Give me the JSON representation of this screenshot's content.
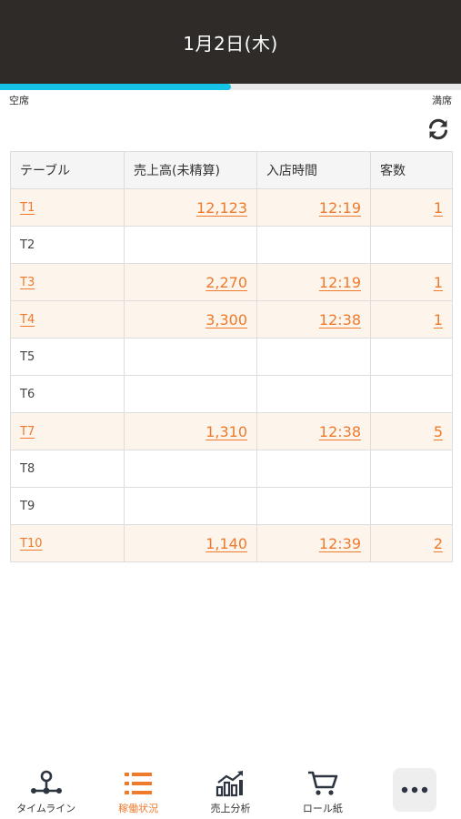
{
  "header": {
    "title": "1月2日(木)"
  },
  "occupancy": {
    "empty_label": "空席",
    "full_label": "満席",
    "level": 0.5
  },
  "table": {
    "headers": [
      "テーブル",
      "売上高(未精算)",
      "入店時間",
      "客数"
    ],
    "rows": [
      {
        "table": "T1",
        "sales": "12,123",
        "time": "12:19",
        "guests": "1",
        "active": true
      },
      {
        "table": "T2",
        "sales": "",
        "time": "",
        "guests": "",
        "active": false
      },
      {
        "table": "T3",
        "sales": "2,270",
        "time": "12:19",
        "guests": "1",
        "active": true
      },
      {
        "table": "T4",
        "sales": "3,300",
        "time": "12:38",
        "guests": "1",
        "active": true
      },
      {
        "table": "T5",
        "sales": "",
        "time": "",
        "guests": "",
        "active": false
      },
      {
        "table": "T6",
        "sales": "",
        "time": "",
        "guests": "",
        "active": false
      },
      {
        "table": "T7",
        "sales": "1,310",
        "time": "12:38",
        "guests": "5",
        "active": true
      },
      {
        "table": "T8",
        "sales": "",
        "time": "",
        "guests": "",
        "active": false
      },
      {
        "table": "T9",
        "sales": "",
        "time": "",
        "guests": "",
        "active": false
      },
      {
        "table": "T10",
        "sales": "1,140",
        "time": "12:39",
        "guests": "2",
        "active": true
      }
    ]
  },
  "nav": {
    "items": [
      {
        "label": "タイムライン",
        "icon": "timeline-icon"
      },
      {
        "label": "稼働状況",
        "icon": "list-icon",
        "active": true
      },
      {
        "label": "売上分析",
        "icon": "chart-icon"
      },
      {
        "label": "ロール紙",
        "icon": "cart-icon"
      },
      {
        "label": "",
        "icon": "more-icon"
      }
    ]
  },
  "colors": {
    "accent": "#ef7a2b",
    "progress": "#14c3e6",
    "header_bg": "#2e2b29",
    "active_row": "#fdf4ec"
  }
}
